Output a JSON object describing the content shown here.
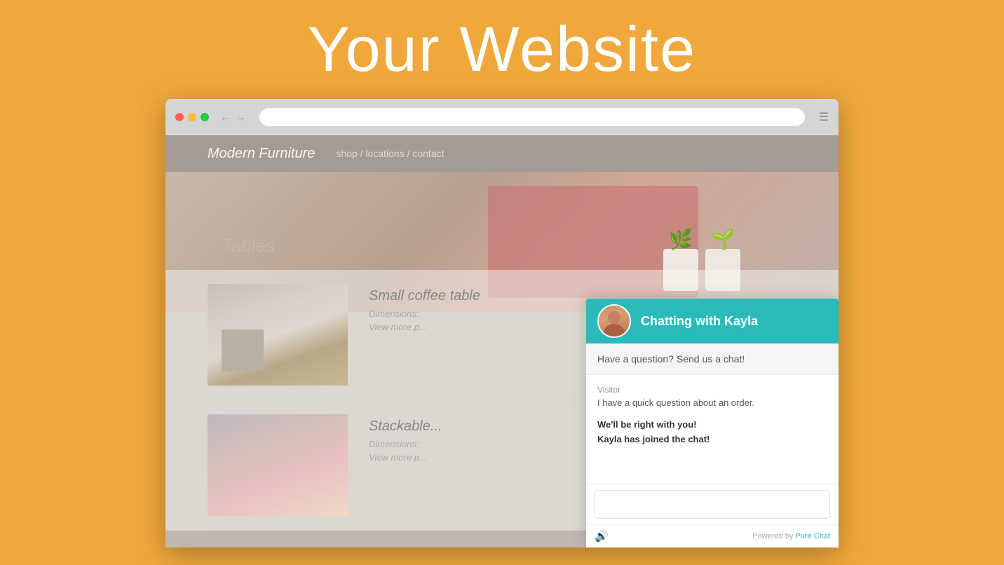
{
  "page": {
    "title": "Your Website",
    "background_color": "#F0A83C"
  },
  "browser": {
    "traffic_lights": [
      "red",
      "yellow",
      "green"
    ]
  },
  "website": {
    "navbar": {
      "logo": "Modern Furniture",
      "nav_links": "shop / locations / contact"
    },
    "tables_section": {
      "title": "Tables"
    },
    "products": [
      {
        "name": "Small coffee table",
        "dimensions": "Dimensions:",
        "link": "View more p..."
      },
      {
        "name": "Stackable...",
        "dimensions": "Dimensions:",
        "link": "View more p..."
      }
    ]
  },
  "chat": {
    "header_title": "Chatting with Kayla",
    "header_bg": "#2BBABA",
    "welcome_message": "Have a question? Send us a chat!",
    "visitor_label": "Visitor",
    "visitor_message": "I have a quick question about an order.",
    "system_message_1": "We'll be right with you!",
    "system_message_2": "Kayla has joined the chat!",
    "input_placeholder": "",
    "powered_by_text": "Powered by ",
    "powered_by_link": "Pure Chat",
    "audio_icon": "🔊"
  }
}
